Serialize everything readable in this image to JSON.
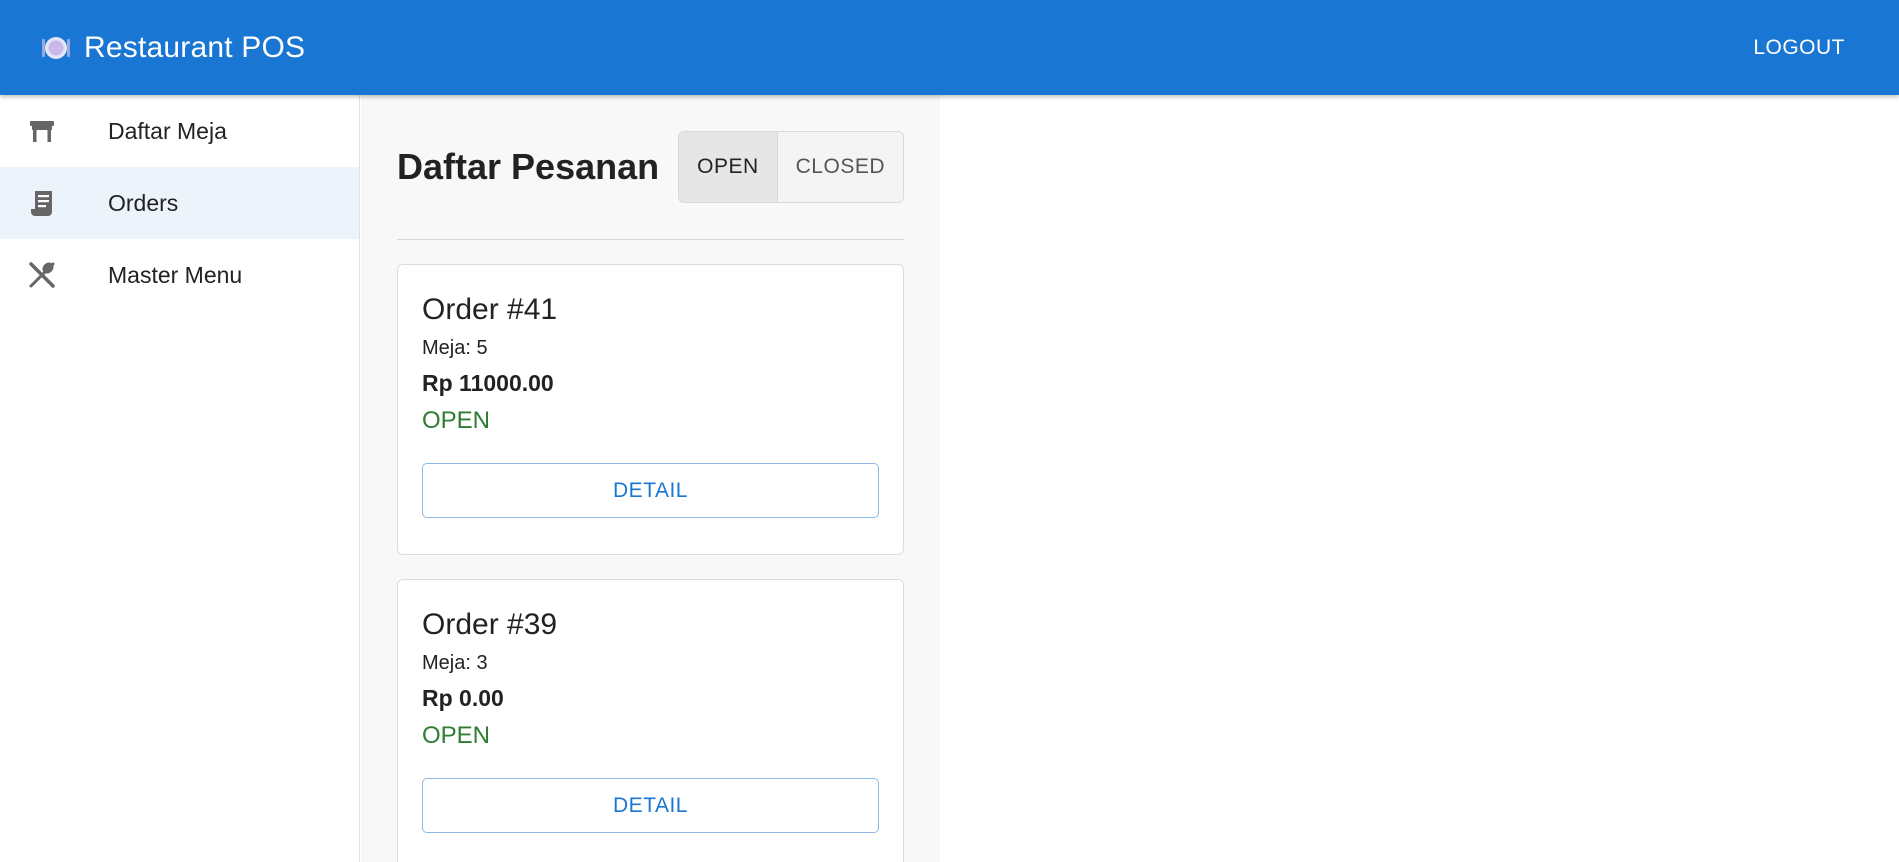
{
  "app": {
    "title": "Restaurant POS",
    "logo_icon": "plate-icon",
    "logout_label": "LOGOUT",
    "brand_color": "#1976d2"
  },
  "sidebar": {
    "items": [
      {
        "label": "Daftar Meja",
        "icon": "table-icon",
        "active": false
      },
      {
        "label": "Orders",
        "icon": "receipt-icon",
        "active": true
      },
      {
        "label": "Master Menu",
        "icon": "cutlery-icon",
        "active": false
      }
    ]
  },
  "main": {
    "title": "Daftar Pesanan",
    "filter": {
      "open_label": "OPEN",
      "closed_label": "CLOSED",
      "selected": "OPEN"
    },
    "orders": [
      {
        "title": "Order #41",
        "table": "Meja: 5",
        "total": "Rp 11000.00",
        "status": "OPEN",
        "detail_label": "DETAIL"
      },
      {
        "title": "Order #39",
        "table": "Meja: 3",
        "total": "Rp 0.00",
        "status": "OPEN",
        "detail_label": "DETAIL"
      }
    ]
  },
  "colors": {
    "status_open": "#2e7d32",
    "detail_button": "#1976d2"
  }
}
